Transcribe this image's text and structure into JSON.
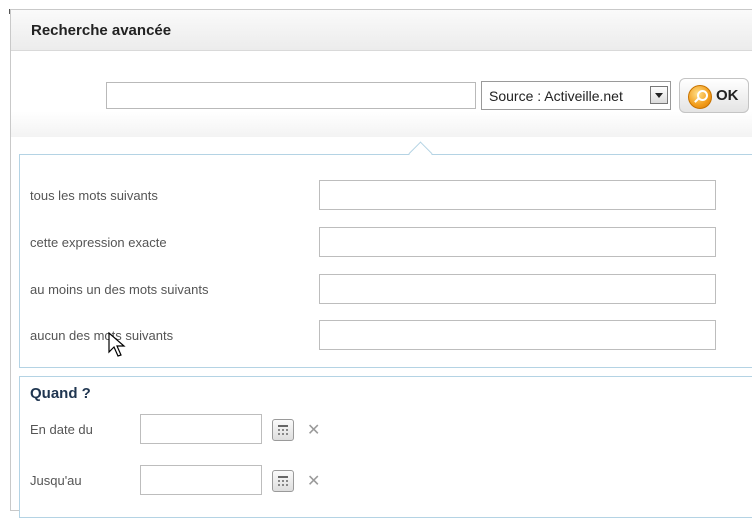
{
  "header": {
    "title": "Recherche avancée"
  },
  "search": {
    "query_value": "",
    "source_label": "Source : Activeille.net",
    "ok_label": "OK"
  },
  "word_filters": [
    {
      "label": "tous les mots suivants",
      "value": ""
    },
    {
      "label": "cette expression exacte",
      "value": ""
    },
    {
      "label": "au moins un des mots suivants",
      "value": ""
    },
    {
      "label": "aucun des mots suivants",
      "value": ""
    }
  ],
  "when": {
    "title": "Quand ?",
    "from_label": "En date du",
    "from_value": "",
    "to_label": "Jusqu'au",
    "to_value": ""
  },
  "icons": {
    "ok": "search-key-icon",
    "calendar": "calendar-icon",
    "clear": "close-icon",
    "dropdown": "chevron-down-icon",
    "cursor": "mouse-pointer-icon"
  }
}
